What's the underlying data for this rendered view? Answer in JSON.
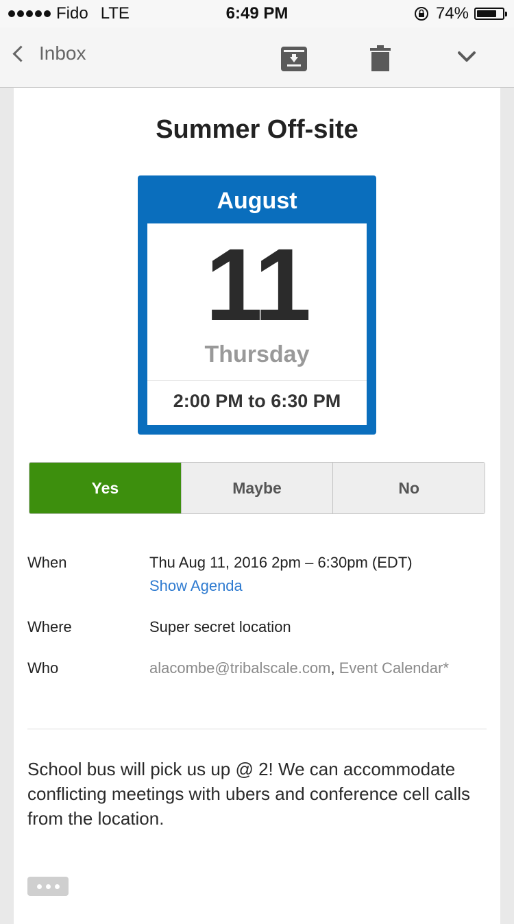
{
  "status_bar": {
    "carrier": "Fido",
    "network": "LTE",
    "time": "6:49 PM",
    "battery": "74%"
  },
  "nav": {
    "back_label": "Inbox"
  },
  "event": {
    "title": "Summer Off-site",
    "month": "August",
    "day": "11",
    "weekday": "Thursday",
    "time_range": "2:00 PM to 6:30 PM"
  },
  "rsvp": {
    "yes": "Yes",
    "maybe": "Maybe",
    "no": "No",
    "selected": "yes"
  },
  "details": {
    "when_label": "When",
    "when_value": "Thu Aug 11, 2016 2pm – 6:30pm (EDT)",
    "show_agenda": "Show Agenda",
    "where_label": "Where",
    "where_value": "Super secret location",
    "who_label": "Who",
    "who_first": "alacombe@tribalscale.com",
    "who_sep": ", ",
    "who_second": "Event Calendar*"
  },
  "description": "School bus will pick us up @ 2! We can accommodate conflicting meetings with ubers and conference cell calls from the location.",
  "colors": {
    "calendar_blue": "#0a6ebd",
    "yes_green": "#3d8f0d",
    "link_blue": "#2f7bd0"
  }
}
